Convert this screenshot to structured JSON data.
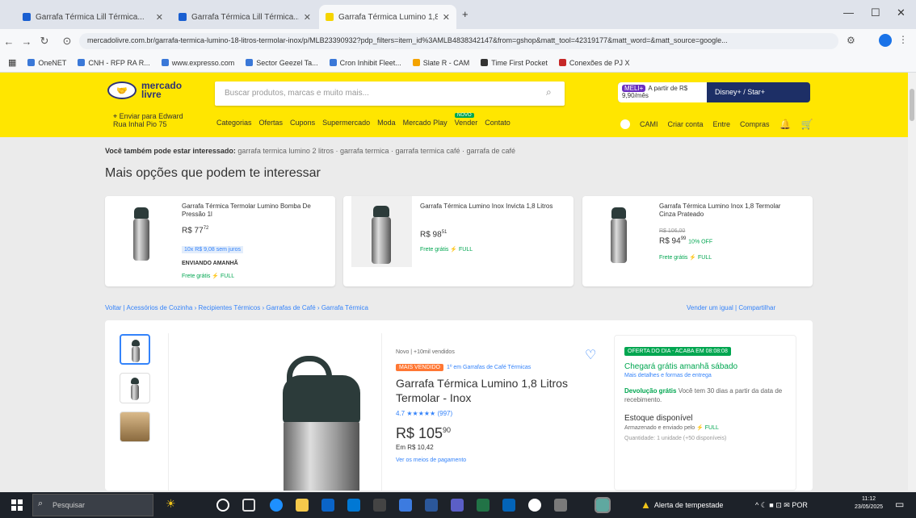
{
  "browser": {
    "tabs": [
      {
        "label": "Garrafa Térmica Lill Térmica...",
        "active": false
      },
      {
        "label": "Garrafa Térmica Lill Térmica...",
        "active": false
      },
      {
        "label": "Garrafa Térmica Lumino 1,8 Li...",
        "active": true
      }
    ],
    "new_tab": "+",
    "url": "mercadolivre.com.br/garrafa-termica-lumino-18-litros-termolar-inox/p/MLB23390932?pdp_filters=item_id%3AMLB4838342147&from=gshop&matt_tool=42319177&matt_word=&matt_source=google...",
    "bookmarks": [
      "OneNET",
      "CNH - RFP RA R...",
      "www.expresso.com",
      "Sector Geezel Ta...",
      "Cron Inhibit Fleet...",
      "Slate R - CAM",
      "Time First Pocket",
      "Conexões de PJ X"
    ]
  },
  "ml_header": {
    "logo_line1": "mercado",
    "logo_line2": "livre",
    "search_placeholder": "Buscar produtos, marcas e muito mais...",
    "promo_badge": "MELI+",
    "promo_text": "A partir de R$ 9,90/mês",
    "promo_price": "R$ 9,90",
    "promo_right": "Disney+ / Star+",
    "delivery_line1": "Enviar para Edward",
    "delivery_line2": "Rua Inhal Pio 75",
    "nav": [
      "Categorias",
      "Ofertas",
      "Cupons",
      "Supermercado",
      "Moda",
      "Mercado Play",
      "Vender",
      "Contato"
    ],
    "nav_new_badge": "NOVO",
    "right_nav": [
      "Criar conta",
      "Entre",
      "Compras"
    ],
    "right_user": "CAMI"
  },
  "related": {
    "label": "Você também pode estar interessado:",
    "links": "garrafa termica lumino 2 litros · garrafa termica · garrafa termica café · garrafa de café"
  },
  "more_options_title": "Mais opções que podem te interessar",
  "options": [
    {
      "title": "Garrafa Térmica Termolar Lumino Bomba De Pressão 1l",
      "price": "R$ 77",
      "price_cents": "72",
      "installments": "10x R$ 9,08 sem juros",
      "tag": "ENVIANDO AMANHÃ",
      "shipping": "Frete grátis ⚡ FULL"
    },
    {
      "title": "Garrafa Térmica Lumino Inox Invicta 1,8 Litros",
      "price": "R$ 98",
      "price_cents": "51",
      "shipping": "Frete grátis ⚡ FULL"
    },
    {
      "title": "Garrafa Térmica Lumino Inox 1,8 Termolar Cinza Prateado",
      "old_price": "R$ 106,00",
      "price": "R$ 94",
      "price_cents": "99",
      "discount": "10% OFF",
      "shipping": "Frete grátis ⚡ FULL"
    }
  ],
  "breadcrumb": "Voltar | Acessórios de Cozinha › Recipientes Térmicos › Garrafas de Café › Garrafa Térmica",
  "share_links": "Vender um igual | Compartilhar",
  "product": {
    "condition": "Novo | +10mil vendidos",
    "bestseller": "MAIS VENDIDO",
    "bestseller_rank": "1º em Garrafas de Café Térmicas",
    "title": "Garrafa Térmica Lumino 1,8 Litros Termolar - Inox",
    "rating_value": "4.7",
    "rating_stars": "★★★★★",
    "rating_count": "(997)",
    "price": "R$ 105",
    "price_cents": "90",
    "price_sub": "Em R$ 10,42",
    "payment_link": "Ver os meios de pagamento",
    "offer_badge": "OFERTA DO DIA - ACABA EM 08:08:08",
    "shipping": "Chegará grátis amanhã sábado",
    "shipping_sub": "Mais detalhes e formas de entrega",
    "returns": "Devolução grátis",
    "returns_sub": "Você tem 30 dias a partir da data de recebimento.",
    "stock": "Estoque disponível",
    "stock_sub": "Armazenado e enviado pelo",
    "stock_full": "⚡ FULL",
    "stock_extra": "Quantidade: 1 unidade (+50 disponíveis)"
  },
  "taskbar": {
    "search_placeholder": "Pesquisar",
    "alert": "Alerta de tempestade",
    "tray": "^ ☾ ■ ⊡ ✉ POR",
    "time": "11:12",
    "date": "23/05/2025"
  },
  "colors": {
    "ml_yellow": "#ffe600",
    "ml_blue": "#3483fa",
    "ml_green": "#00a650",
    "taskbar": "#1d2229"
  }
}
